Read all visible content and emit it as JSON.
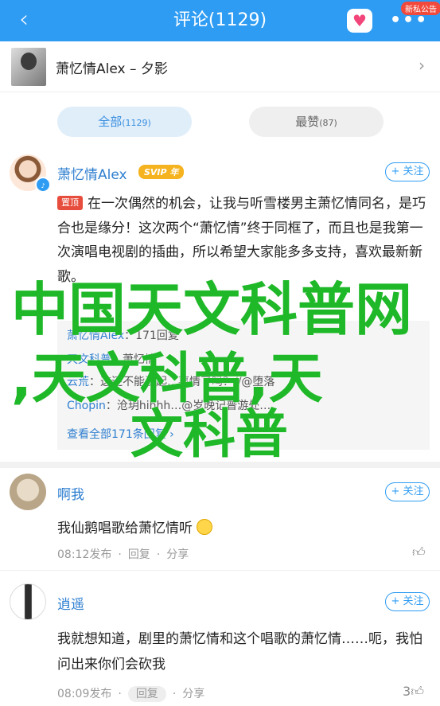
{
  "topbar": {
    "back_icon": "‹",
    "title": "评论(1129)",
    "heart_icon": "♥",
    "more_icon": "•••",
    "badge": "新私公告"
  },
  "song": {
    "title": "萧忆情Alex – 夕影",
    "chevron": "›"
  },
  "tabs": {
    "all_label": "全部",
    "all_count": "(1129)",
    "hot_label": "最赞",
    "hot_count": "(87)"
  },
  "comments": [
    {
      "user": "萧忆情Alex",
      "vip": "SVIP 年",
      "follow": "+ 关注",
      "pin": "置顶",
      "text": "在一次偶然的机会，让我与听雪楼男主萧忆情同名，是巧合也是缘分！这次两个“萧忆情”终于同框了，而且也是我第一次演唱电视剧的插曲，所以希望大家能多多支持，喜欢最新新歌。",
      "replies": [
        {
          "name": "萧忆情Alex",
          "text": "：171回复"
        },
        {
          "name": "天文科普",
          "text": "：萧忆情"
        },
        {
          "name": "云荒",
          "text": "：这还不能引起…事情了吗？//@堕落"
        },
        {
          "name": "Chopin",
          "text": "：沧玥hihhh…@岁晚记普游处…"
        }
      ],
      "view_all": "查看全部171条回复 ›"
    },
    {
      "user": "啊我",
      "follow": "+ 关注",
      "text": "我仙鹅唱歌给萧忆情听",
      "time": "08:12发布",
      "reply": "回复",
      "share": "分享",
      "likes": ""
    },
    {
      "user": "逍遥",
      "follow": "+ 关注",
      "text": "我就想知道，剧里的萧忆情和这个唱歌的萧忆情……呃，我怕问出来你们会砍我",
      "time": "08:09发布",
      "reply": "回复",
      "share": "分享",
      "likes": "3"
    }
  ],
  "watermark": {
    "line1": "中国天文科普网",
    "line2": ",天文科普,天",
    "line3": "文科普"
  },
  "colors": {
    "topbar": "#2f9cf3",
    "link": "#2f7fd0",
    "watermark": "#1fb828"
  }
}
